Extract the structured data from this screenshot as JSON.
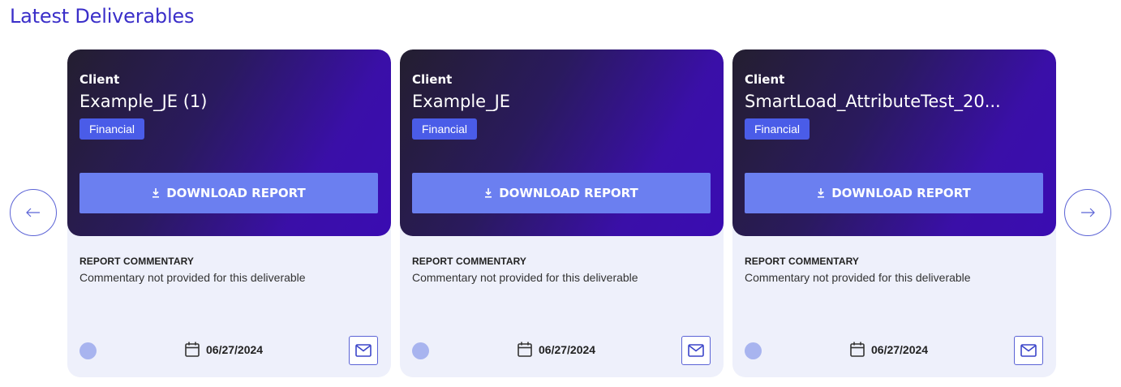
{
  "page": {
    "title": "Latest Deliverables"
  },
  "cards": [
    {
      "client_label": "Client",
      "client_name": "Example_JE (1)",
      "tag": "Financial",
      "download_label": "DOWNLOAD REPORT",
      "commentary_label": "REPORT COMMENTARY",
      "commentary_text": "Commentary not provided for this deliverable",
      "date": "06/27/2024"
    },
    {
      "client_label": "Client",
      "client_name": "Example_JE",
      "tag": "Financial",
      "download_label": "DOWNLOAD REPORT",
      "commentary_label": "REPORT COMMENTARY",
      "commentary_text": "Commentary not provided for this deliverable",
      "date": "06/27/2024"
    },
    {
      "client_label": "Client",
      "client_name": "SmartLoad_AttributeTest_20...",
      "tag": "Financial",
      "download_label": "DOWNLOAD REPORT",
      "commentary_label": "REPORT COMMENTARY",
      "commentary_text": "Commentary not provided for this deliverable",
      "date": "06/27/2024"
    }
  ],
  "icons": {
    "prev": "arrow-left-icon",
    "next": "arrow-right-icon",
    "download": "download-icon",
    "calendar": "calendar-icon",
    "mail": "mail-icon"
  },
  "colors": {
    "title": "#3b2fc9",
    "accent": "#6b7ff0",
    "tag": "#4a5ce8",
    "card_bg": "#eef0fb",
    "header_gradient_start": "#241e30",
    "header_gradient_end": "#3a0cb2"
  }
}
